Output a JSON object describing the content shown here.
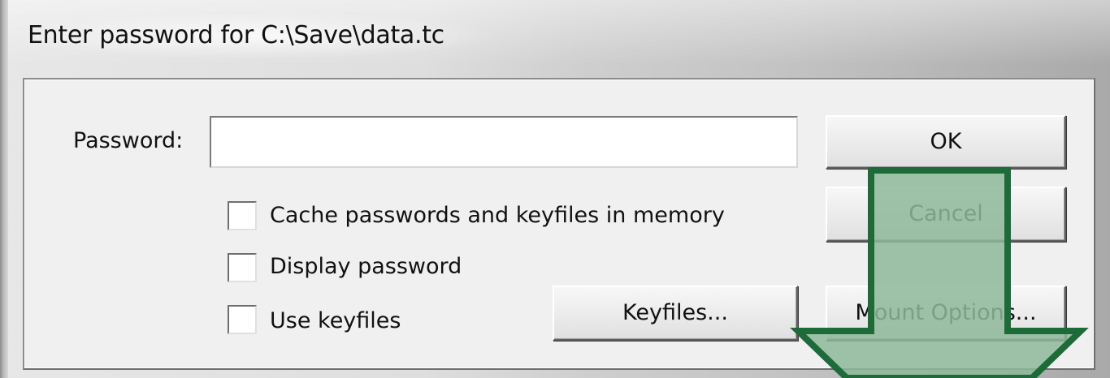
{
  "window": {
    "title": "Enter password for C:\\Save\\data.tc"
  },
  "form": {
    "password_label": "Password:",
    "password_value": "",
    "checkboxes": [
      {
        "label": "Cache passwords and keyfiles in memory",
        "checked": false
      },
      {
        "label": "Display password",
        "checked": false
      },
      {
        "label": "Use keyfiles",
        "checked": false
      }
    ]
  },
  "buttons": {
    "ok": "OK",
    "cancel": "Cancel",
    "keyfiles": "Keyfiles...",
    "mount_options": "Mount Options..."
  },
  "overlay": {
    "arrow_direction": "down",
    "arrow_fill": "#8db99a",
    "arrow_stroke": "#1e6b3a"
  }
}
